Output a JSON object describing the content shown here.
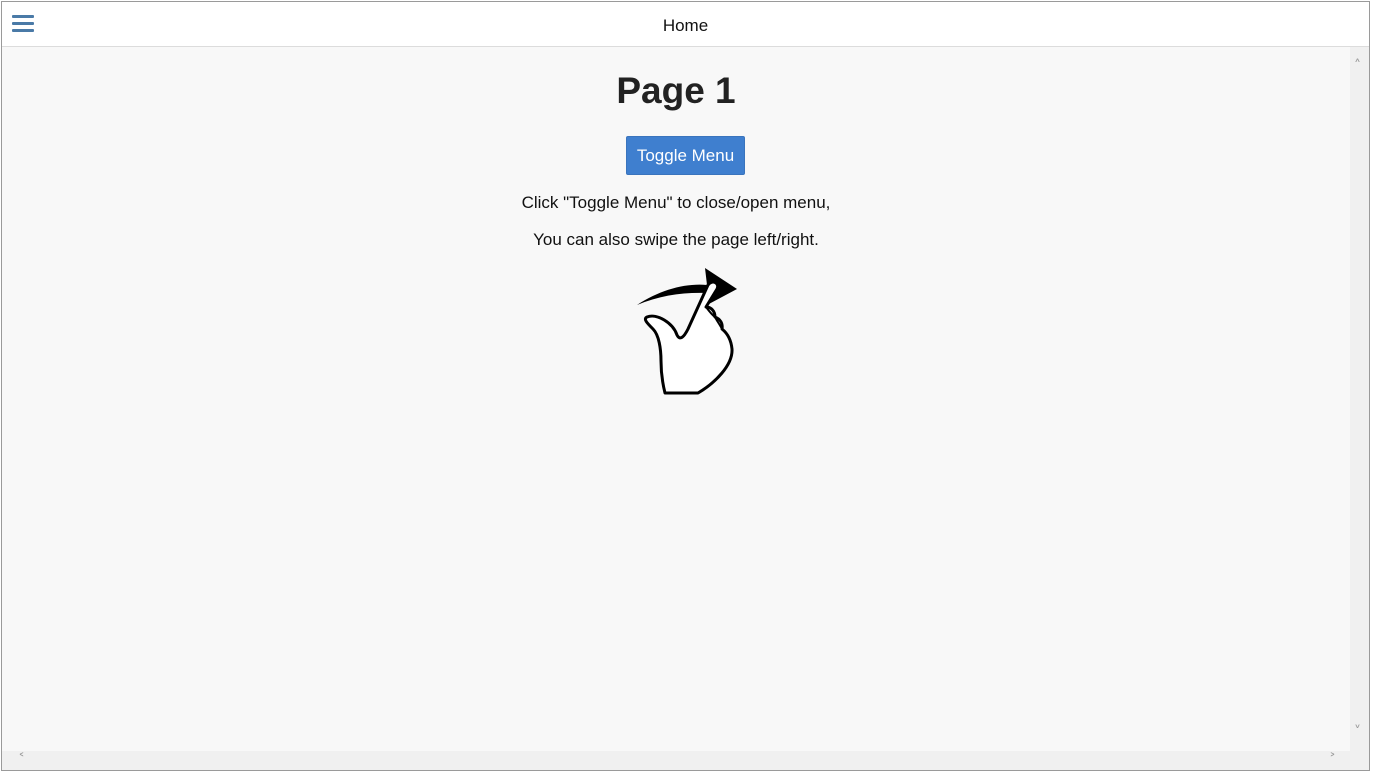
{
  "header": {
    "title": "Home",
    "menu_icon": "hamburger-menu-icon",
    "accent_color": "#4a7aa7"
  },
  "main": {
    "page_title": "Page 1",
    "toggle_button_label": "Toggle Menu",
    "toggle_button_color": "#3f7fcf",
    "instruction_line1": "Click \"Toggle Menu\" to close/open menu,",
    "instruction_line2": "You can also swipe the page left/right.",
    "swipe_icon": "swipe-gesture-icon"
  },
  "scrollbars": {
    "up_arrow": "^",
    "down_arrow": "v",
    "left_arrow": "<",
    "right_arrow": ">"
  }
}
